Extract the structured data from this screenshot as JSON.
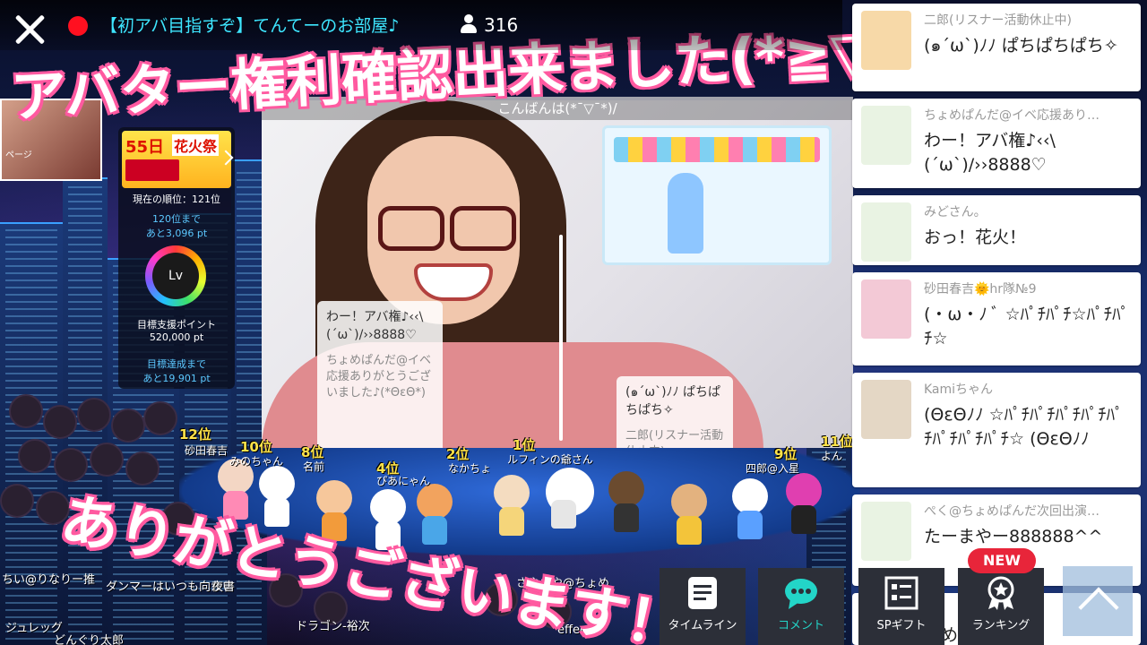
{
  "header": {
    "room_title": "【初アバ目指すぞ】てんてーのお部屋♪",
    "viewer_count": "316"
  },
  "overlay": {
    "banner_top": "アバター権利確認出来ました(*≧▽≦)",
    "banner_bottom": "ありがとうございます！"
  },
  "video": {
    "caption": "こんばんは(*¯▽¯*)/",
    "cards": [
      {
        "text": "わー！アバ権♪‹‹\\(´ω`)/››8888♡",
        "name": "ちょめぱんだ@イベ応援ありがとうございました♪(*ΘεΘ*)"
      },
      {
        "text": "(๑´ω`)ﾉﾉ ぱちぱちぱち✧",
        "name": "二郎(リスナー活動休止中)"
      }
    ]
  },
  "event_panel": {
    "banner_days": "55日",
    "banner_title": "花火祭",
    "current_rank": "現在の順位：121位",
    "next_rank_line1": "120位まで",
    "next_rank_line2": "あと3,096 pt",
    "level_label": "Lv",
    "goal_label": "目標支援ポイント",
    "goal_value": "520,000 pt",
    "achieve_line1": "目標達成まで",
    "achieve_line2": "あと19,901 pt"
  },
  "mini_thumb": {
    "label": "ページ"
  },
  "stage": {
    "ranks": [
      {
        "rank": "12位",
        "name": "砂田春吉"
      },
      {
        "rank": "10位",
        "name": "みのちゃん"
      },
      {
        "rank": "8位",
        "name": "名前"
      },
      {
        "rank": "4位",
        "name": "ぴあにゃん"
      },
      {
        "rank": "2位",
        "name": "なかちょ"
      },
      {
        "rank": "1位",
        "name": "ルフィンの爺さん"
      },
      {
        "rank": "9位",
        "name": "四郎@入星"
      },
      {
        "rank": "11位",
        "name": "よん"
      }
    ]
  },
  "ticker": [
    "ちい@りなりー推",
    "ダンマーはいつも向かい",
    "夜書",
    "ジュレッグ",
    "どんぐり太郎",
    "ドラゴン-裕次",
    "effector",
    "さやさや@ちょめ"
  ],
  "comments": [
    {
      "name": "二郎(リスナー活動休止中)",
      "text": "(๑´ω`)ﾉﾉ ぱちぱちぱち✧",
      "avatar_color": "#f7d9a8"
    },
    {
      "name": "ちょめぱんだ@イベ応援あり…",
      "text": "わー！アバ権♪‹‹\\(´ω`)/››8888♡",
      "avatar_color": "#e9f3e3"
    },
    {
      "name": "みどさん。",
      "text": "おっ！花火！",
      "avatar_color": "#e9f3e3"
    },
    {
      "name": "砂田春吉🌞hr隊№9",
      "text": "(・ω・ﾉ ﾞ ☆ﾊﾟﾁﾊﾟﾁ☆ﾊﾟﾁﾊﾟﾁ☆",
      "avatar_color": "#f3c9d6"
    },
    {
      "name": "Kamiちゃん",
      "text": "(ΘεΘﾉﾉ ☆ﾊﾟﾁﾊﾟﾁﾊﾟﾁﾊﾟﾁﾊﾟﾁﾊﾟﾁﾊﾟﾁﾊﾟﾁ☆ (ΘεΘﾉﾉ",
      "avatar_color": "#e4d7c5"
    },
    {
      "name": "ぺく@ちょめぱんだ次回出演…",
      "text": "たーまやー888888^^",
      "avatar_color": "#e9f3e3"
    },
    {
      "name": "",
      "text": "おめでとー",
      "avatar_color": "#e9f3e3"
    }
  ],
  "actions": {
    "timeline": "タイムライン",
    "comment": "コメント",
    "sp_gift": "SPギフト",
    "ranking": "ランキング",
    "new_badge": "NEW"
  },
  "colors": {
    "accent": "#23d5c8",
    "live": "#ff1020",
    "title": "#3ee6ff",
    "badge": "#e8253a"
  }
}
